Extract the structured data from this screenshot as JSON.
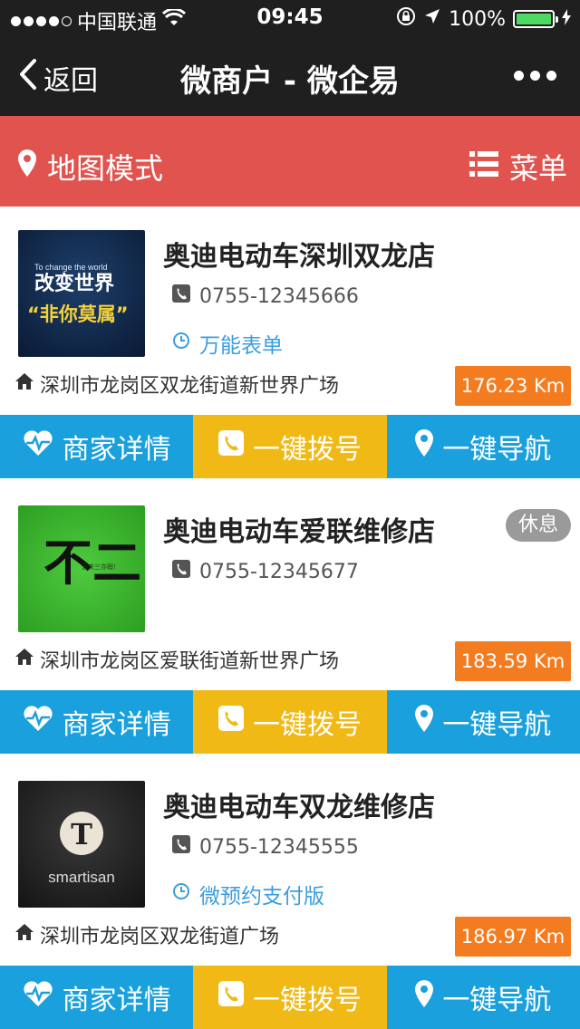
{
  "status": {
    "carrier": "中国联通",
    "time": "09:45",
    "battery": "100%"
  },
  "nav": {
    "back_label": "返回",
    "title": "微商户 - 微企易",
    "more_icon": "more-dots-icon"
  },
  "toolbar": {
    "map_mode": "地图模式",
    "menu": "菜单"
  },
  "colors": {
    "red_bar": "#e0534f",
    "blue_button": "#1aa0dc",
    "yellow_button": "#f0b915",
    "distance_tag": "#f47c20"
  },
  "stores": [
    {
      "name": "奥迪电动车深圳双龙店",
      "phone": "0755-12345666",
      "extra": "万能表单",
      "address": "深圳市龙岗区双龙街道新世界广场",
      "distance": "176.23 Km",
      "thumb_small": "To change the world",
      "thumb_big": "改变世界",
      "thumb_quote": "“非你莫属”"
    },
    {
      "name": "奥迪电动车爱联维修店",
      "phone": "0755-12345677",
      "badge": "休息",
      "address": "深圳市龙岗区爱联街道新世界广场",
      "distance": "183.59 Km",
      "thumb_big": "不二",
      "thumb_small": "云来三亦暇！"
    },
    {
      "name": "奥迪电动车双龙维修店",
      "phone": "0755-12345555",
      "extra": "微预约支付版",
      "address": "深圳市龙岗区双龙街道广场",
      "distance": "186.97 Km",
      "thumb_big": "T",
      "thumb_small": "smartisan"
    }
  ],
  "actions": {
    "detail": "商家详情",
    "call": "一键拨号",
    "navigate": "一键导航"
  }
}
